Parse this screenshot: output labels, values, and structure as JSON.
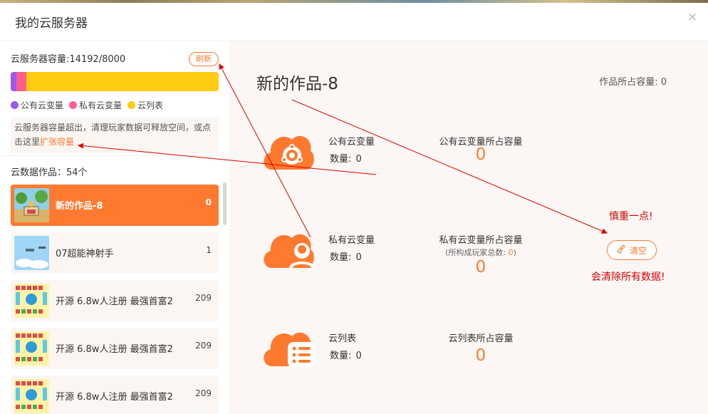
{
  "dialog": {
    "title": "我的云服务器",
    "close_glyph": "×"
  },
  "left": {
    "capacity_label": "云服务器容量:14192/8000",
    "refresh_label": "刷新",
    "legend": [
      {
        "label": "公有云变量",
        "color": "#9b59f2"
      },
      {
        "label": "私有云变量",
        "color": "#ff5e8a"
      },
      {
        "label": "云列表",
        "color": "#ffcc11"
      }
    ],
    "notice_text": "云服务器容量超出，清理玩家数据可释放空间，或点击这里",
    "notice_link": "扩张容量",
    "works_label": "云数据作品：54个",
    "works": [
      {
        "name": "新的作品-8",
        "count": "0",
        "active": true
      },
      {
        "name": "07超能神射手",
        "count": "1"
      },
      {
        "name": "开源 6.8w人注册 最强首富2",
        "count": "209"
      },
      {
        "name": "开源 6.8w人注册 最强首富2",
        "count": "209"
      },
      {
        "name": "开源 6.8w人注册 最强首富2",
        "count": "209"
      }
    ]
  },
  "right": {
    "work_title": "新的作品-8",
    "work_capacity": "作品所占容量: 0",
    "public": {
      "name": "公有云变量",
      "qty_label": "数量:",
      "qty": "0",
      "cap_title": "公有云变量所占容量",
      "cap_value": "0"
    },
    "private": {
      "name": "私有云变量",
      "qty_label": "数量:",
      "qty": "0",
      "cap_title": "私有云变量所占容量",
      "cap_sub_prefix": "(所构成玩家总数: ",
      "cap_sub_num": "0",
      "cap_sub_suffix": ")",
      "cap_value": "0"
    },
    "list": {
      "name": "云列表",
      "qty_label": "数量:",
      "qty": "0",
      "cap_title": "云列表所占容量",
      "cap_value": "0"
    },
    "clear_label": "清空",
    "annotation_careful": "慎重一点!",
    "annotation_warning": "会清除所有数据!"
  },
  "colors": {
    "accent": "#ff7a2f",
    "annotation": "#d10000"
  }
}
